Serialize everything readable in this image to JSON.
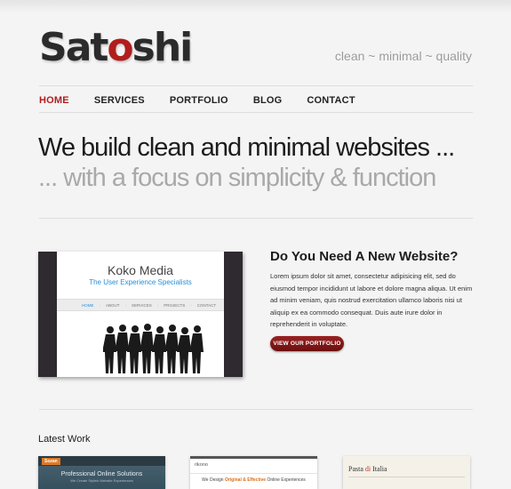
{
  "header": {
    "logo_main": "Sat",
    "logo_accent": "o",
    "logo_rest": "shi",
    "tagline": "clean ~ minimal ~ quality"
  },
  "nav": {
    "items": [
      {
        "label": "HOME",
        "active": true
      },
      {
        "label": "SERVICES",
        "active": false
      },
      {
        "label": "PORTFOLIO",
        "active": false
      },
      {
        "label": "BLOG",
        "active": false
      },
      {
        "label": "CONTACT",
        "active": false
      }
    ]
  },
  "hero": {
    "line1": "We build clean and minimal websites ...",
    "line2": "... with a focus on simplicity & function"
  },
  "featured": {
    "screenshot": {
      "brand": "Koko Media",
      "subtitle": "The User Experience Specialists",
      "menu": [
        "HOME",
        "ABOUT",
        "SERVICES",
        "PROJECTS",
        "CONTACT"
      ]
    },
    "title": "Do You Need A New Website?",
    "body": "Lorem ipsum dolor sit amet, consectetur adipisicing elit, sed do eiusmod tempor incididunt ut labore et dolore magna aliqua. Ut enim ad minim veniam, quis nostrud exercitation ullamco laboris nisi ut aliquip ex ea commodo consequat. Duis aute irure dolor in reprehenderit in voluptate.",
    "button": "VIEW OUR PORTFOLIO"
  },
  "latest_work": {
    "title": "Latest Work",
    "items": [
      {
        "logo": "Sozan",
        "heading": "Professional Online Solutions",
        "sub": "We Create Stylish Website Experiences"
      },
      {
        "logo": "rikono",
        "heading_pre": "We Design ",
        "heading_accent": "Original & Effective",
        "heading_post": " Online Experiences"
      },
      {
        "logo_a": "Pasta ",
        "logo_amp": "di",
        "logo_b": " Italia"
      }
    ]
  },
  "colors": {
    "accent": "#b01e1e",
    "background": "#f4f4f4",
    "link_blue": "#2a8ed6"
  }
}
